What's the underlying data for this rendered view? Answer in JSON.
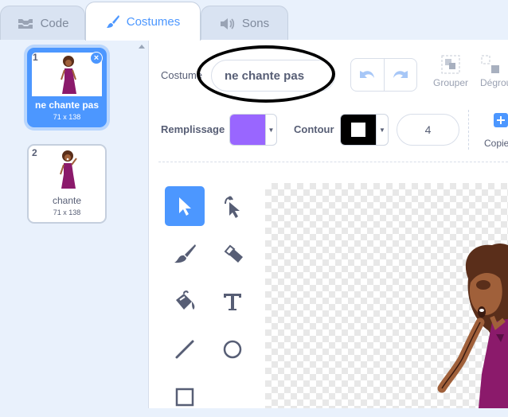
{
  "tabs": {
    "code": "Code",
    "costumes": "Costumes",
    "sounds": "Sons"
  },
  "costume_list": [
    {
      "number": "1",
      "name": "ne chante pas",
      "size": "71 x 138"
    },
    {
      "number": "2",
      "name": "chante",
      "size": "71 x 138"
    }
  ],
  "editor": {
    "costume_label": "Costume",
    "costume_name": "ne chante pas",
    "group_label": "Grouper",
    "ungroup_label": "Dégrou",
    "fill_label": "Remplissage",
    "outline_label": "Contour",
    "outline_width": "4",
    "copy_label": "Copie",
    "fill_color": "#9966ff",
    "outline_color": "#000000"
  },
  "colors": {
    "accent": "#4c97ff",
    "text": "#575e75"
  }
}
